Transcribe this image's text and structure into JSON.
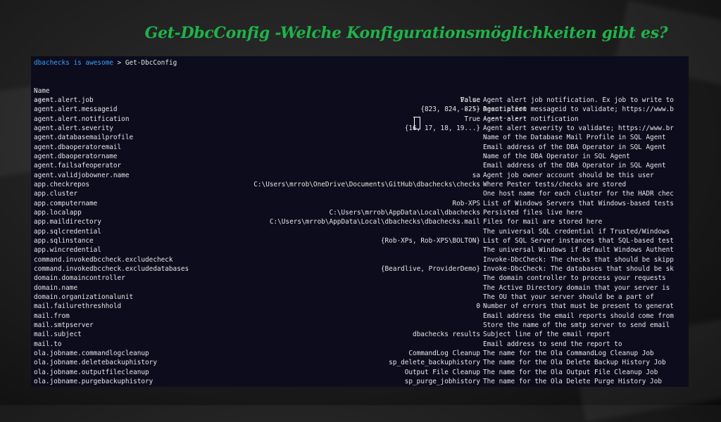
{
  "slide": {
    "title": "Get-DbcConfig -Welche Konfigurationsmöglichkeiten gibt es?"
  },
  "terminal": {
    "prompt_user": "dbachecks is awesome",
    "prompt_arrow": ">",
    "command": "Get-DbcConfig",
    "headers": {
      "name": "Name",
      "value": "Value",
      "description": "Description"
    },
    "separators": {
      "name": "----",
      "value": "-----",
      "description": "-----------"
    },
    "rows": [
      {
        "name": "agent.alert.job",
        "value": "False",
        "description": "Agent alert job notification. Ex job to write to"
      },
      {
        "name": "agent.alert.messageid",
        "value": "{823, 824, 825}",
        "description": "Agent alert messageid to validate; https://www.b"
      },
      {
        "name": "agent.alert.notification",
        "value": "True",
        "description": "Agent alert notification"
      },
      {
        "name": "agent.alert.severity",
        "value": "{16, 17, 18, 19...}",
        "description": "Agent alert severity to validate; https://www.br"
      },
      {
        "name": "agent.databasemailprofile",
        "value": "",
        "description": "Name of the Database Mail Profile in SQL Agent"
      },
      {
        "name": "agent.dbaoperatoremail",
        "value": "",
        "description": "Email address of the DBA Operator in SQL Agent"
      },
      {
        "name": "agent.dbaoperatorname",
        "value": "",
        "description": "Name of the DBA Operator in SQL Agent"
      },
      {
        "name": "agent.failsafeoperator",
        "value": "",
        "description": "Email address of the DBA Operator in SQL Agent"
      },
      {
        "name": "agent.validjobowner.name",
        "value": "sa",
        "description": "Agent job owner account should be this user"
      },
      {
        "name": "app.checkrepos",
        "value": "C:\\Users\\mrrob\\OneDrive\\Documents\\GitHub\\dbachecks\\checks",
        "description": "Where Pester tests/checks are stored"
      },
      {
        "name": "app.cluster",
        "value": "",
        "description": "One host name for each cluster for the HADR chec"
      },
      {
        "name": "app.computername",
        "value": "Rob-XPS",
        "description": "List of Windows Servers that Windows-based tests"
      },
      {
        "name": "app.localapp",
        "value": "C:\\Users\\mrrob\\AppData\\Local\\dbachecks",
        "description": "Persisted files live here"
      },
      {
        "name": "app.maildirectory",
        "value": "C:\\Users\\mrrob\\AppData\\Local\\dbachecks\\dbachecks.mail",
        "description": "Files for mail are stored here"
      },
      {
        "name": "app.sqlcredential",
        "value": "",
        "description": "The universal SQL credential if Trusted/Windows"
      },
      {
        "name": "app.sqlinstance",
        "value": "{Rob-XPs, Rob-XPS\\BOLTON}",
        "description": "List of SQL Server instances that SQL-based test"
      },
      {
        "name": "app.wincredential",
        "value": "",
        "description": "The universal Windows if default Windows Authent"
      },
      {
        "name": "command.invokedbccheck.excludecheck",
        "value": "",
        "description": "Invoke-DbcCheck: The checks that should be skipp"
      },
      {
        "name": "command.invokedbccheck.excludedatabases",
        "value": "{Beardlive, ProviderDemo}",
        "description": "Invoke-DbcCheck: The databases that should be sk"
      },
      {
        "name": "domain.domaincontroller",
        "value": "",
        "description": "The domain controller to process your requests"
      },
      {
        "name": "domain.name",
        "value": "",
        "description": "The Active Directory domain that your server is"
      },
      {
        "name": "domain.organizationalunit",
        "value": "",
        "description": "The OU that your server should be a part of"
      },
      {
        "name": "mail.failurethreshhold",
        "value": "0",
        "description": "Number of errors that must be present to generat"
      },
      {
        "name": "mail.from",
        "value": "",
        "description": "Email address the email reports should come from"
      },
      {
        "name": "mail.smtpserver",
        "value": "",
        "description": "Store the name of the smtp server to send email"
      },
      {
        "name": "mail.subject",
        "value": "dbachecks results",
        "description": "Subject line of the email report"
      },
      {
        "name": "mail.to",
        "value": "",
        "description": "Email address to send the report to"
      },
      {
        "name": "ola.jobname.commandlogcleanup",
        "value": "CommandLog Cleanup",
        "description": "The name for the Ola CommandLog Cleanup Job"
      },
      {
        "name": "ola.jobname.deletebackuphistory",
        "value": "sp_delete_backuphistory",
        "description": "The name for the Ola Delete Backup History Job"
      },
      {
        "name": "ola.jobname.outputfilecleanup",
        "value": "Output File Cleanup",
        "description": "The name for the Ola Output File Cleanup Job"
      },
      {
        "name": "ola.jobname.purgebackuphistory",
        "value": "sp_purge_jobhistory",
        "description": "The name for the Ola Delete Purge History Job"
      }
    ]
  },
  "colors": {
    "title": "#1fb34a",
    "terminal_bg": "#0c0c1d",
    "prompt_user": "#3aa0ff",
    "terminal_text": "#e6e6e6"
  },
  "icons": {
    "cursor": "text-cursor-icon"
  }
}
